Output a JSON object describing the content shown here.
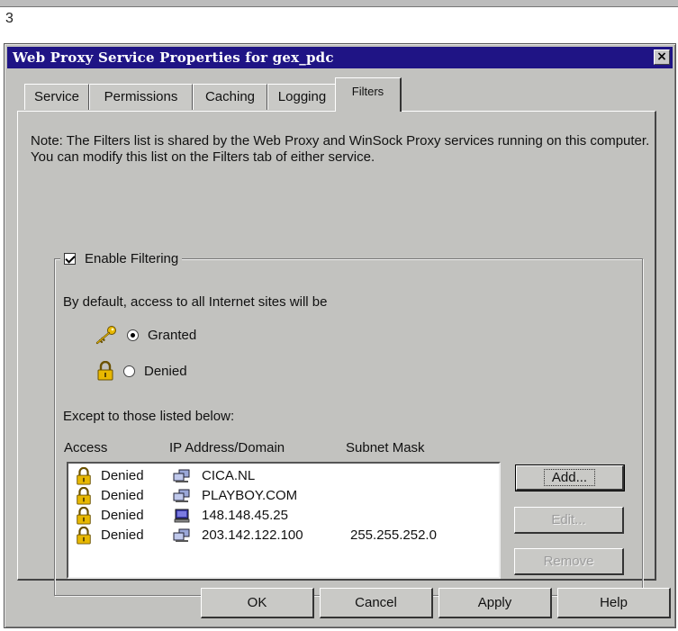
{
  "figure_number": "3",
  "window": {
    "title": "Web Proxy Service Properties for gex_pdc",
    "close_glyph": "×"
  },
  "tabs": [
    {
      "label": "Service"
    },
    {
      "label": "Permissions"
    },
    {
      "label": "Caching"
    },
    {
      "label": "Logging"
    },
    {
      "label": "Filters",
      "active": true
    }
  ],
  "note": "Note: The Filters list is shared by the Web Proxy and WinSock Proxy services running on this computer. You can modify this list on the Filters tab of either service.",
  "filtering": {
    "enable_label": "Enable Filtering",
    "enabled": true,
    "default_text": "By default, access to all Internet sites will be",
    "options": [
      {
        "label": "Granted",
        "selected": true,
        "icon": "key-icon"
      },
      {
        "label": "Denied",
        "selected": false,
        "icon": "lock-icon"
      }
    ],
    "except_text": "Except to those listed below:"
  },
  "list": {
    "columns": [
      "Access",
      "IP Address/Domain",
      "Subnet Mask"
    ],
    "rows": [
      {
        "access": "Denied",
        "address": "CICA.NL",
        "mask": "",
        "icon": "domain-icon"
      },
      {
        "access": "Denied",
        "address": "PLAYBOY.COM",
        "mask": "",
        "icon": "domain-icon"
      },
      {
        "access": "Denied",
        "address": "148.148.45.25",
        "mask": "",
        "icon": "computer-icon"
      },
      {
        "access": "Denied",
        "address": "203.142.122.100",
        "mask": "255.255.252.0",
        "icon": "network-icon"
      }
    ]
  },
  "side_buttons": {
    "add": "Add...",
    "edit": "Edit...",
    "remove": "Remove"
  },
  "footer_buttons": {
    "ok": "OK",
    "cancel": "Cancel",
    "apply": "Apply",
    "help": "Help"
  },
  "colors": {
    "titlebar": "#1f1485",
    "dialog_face": "#c2c2bf",
    "lock_gold": "#e8b800"
  }
}
